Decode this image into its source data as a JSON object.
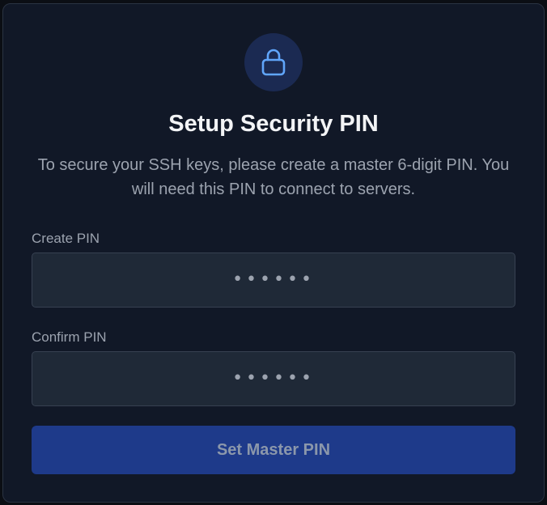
{
  "dialog": {
    "icon": "lock-icon",
    "title": "Setup Security PIN",
    "subtitle": "To secure your SSH keys, please create a master 6-digit PIN. You will need this PIN to connect to servers.",
    "create_pin": {
      "label": "Create PIN",
      "value": "••••••"
    },
    "confirm_pin": {
      "label": "Confirm PIN",
      "value": "••••••"
    },
    "submit_label": "Set Master PIN"
  },
  "colors": {
    "background": "#111827",
    "accent": "#1e3a8a",
    "icon": "#60a5fa"
  }
}
